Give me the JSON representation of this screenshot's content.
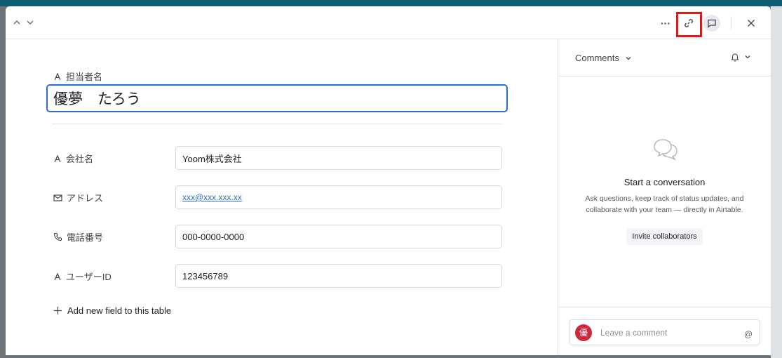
{
  "header": {
    "more_label": "···",
    "link_icon": "link-icon",
    "comment_icon": "comment-icon",
    "close_icon": "close-icon"
  },
  "record": {
    "primary_field_label": "担当者名",
    "primary_value": "優夢　たろう",
    "fields": [
      {
        "label": "会社名",
        "icon": "text-icon",
        "value": "Yoom株式会社"
      },
      {
        "label": "アドレス",
        "icon": "email-icon",
        "value": "xxx@xxx.xxx.xx"
      },
      {
        "label": "電話番号",
        "icon": "phone-icon",
        "value": "000-0000-0000"
      },
      {
        "label": "ユーザーID",
        "icon": "text-icon",
        "value": "123456789"
      }
    ],
    "add_field_label": "Add new field to this table"
  },
  "comments": {
    "title": "Comments",
    "empty_title": "Start a conversation",
    "empty_text": "Ask questions, keep track of status updates, and collaborate with your team — directly in Airtable.",
    "invite_label": "Invite collaborators",
    "avatar_initial": "優",
    "placeholder": "Leave a comment",
    "mention_label": "@"
  },
  "colors": {
    "accent": "#2f6fcf",
    "highlight": "#e01919",
    "avatar": "#d3263a",
    "topbar": "#0d5d75"
  }
}
